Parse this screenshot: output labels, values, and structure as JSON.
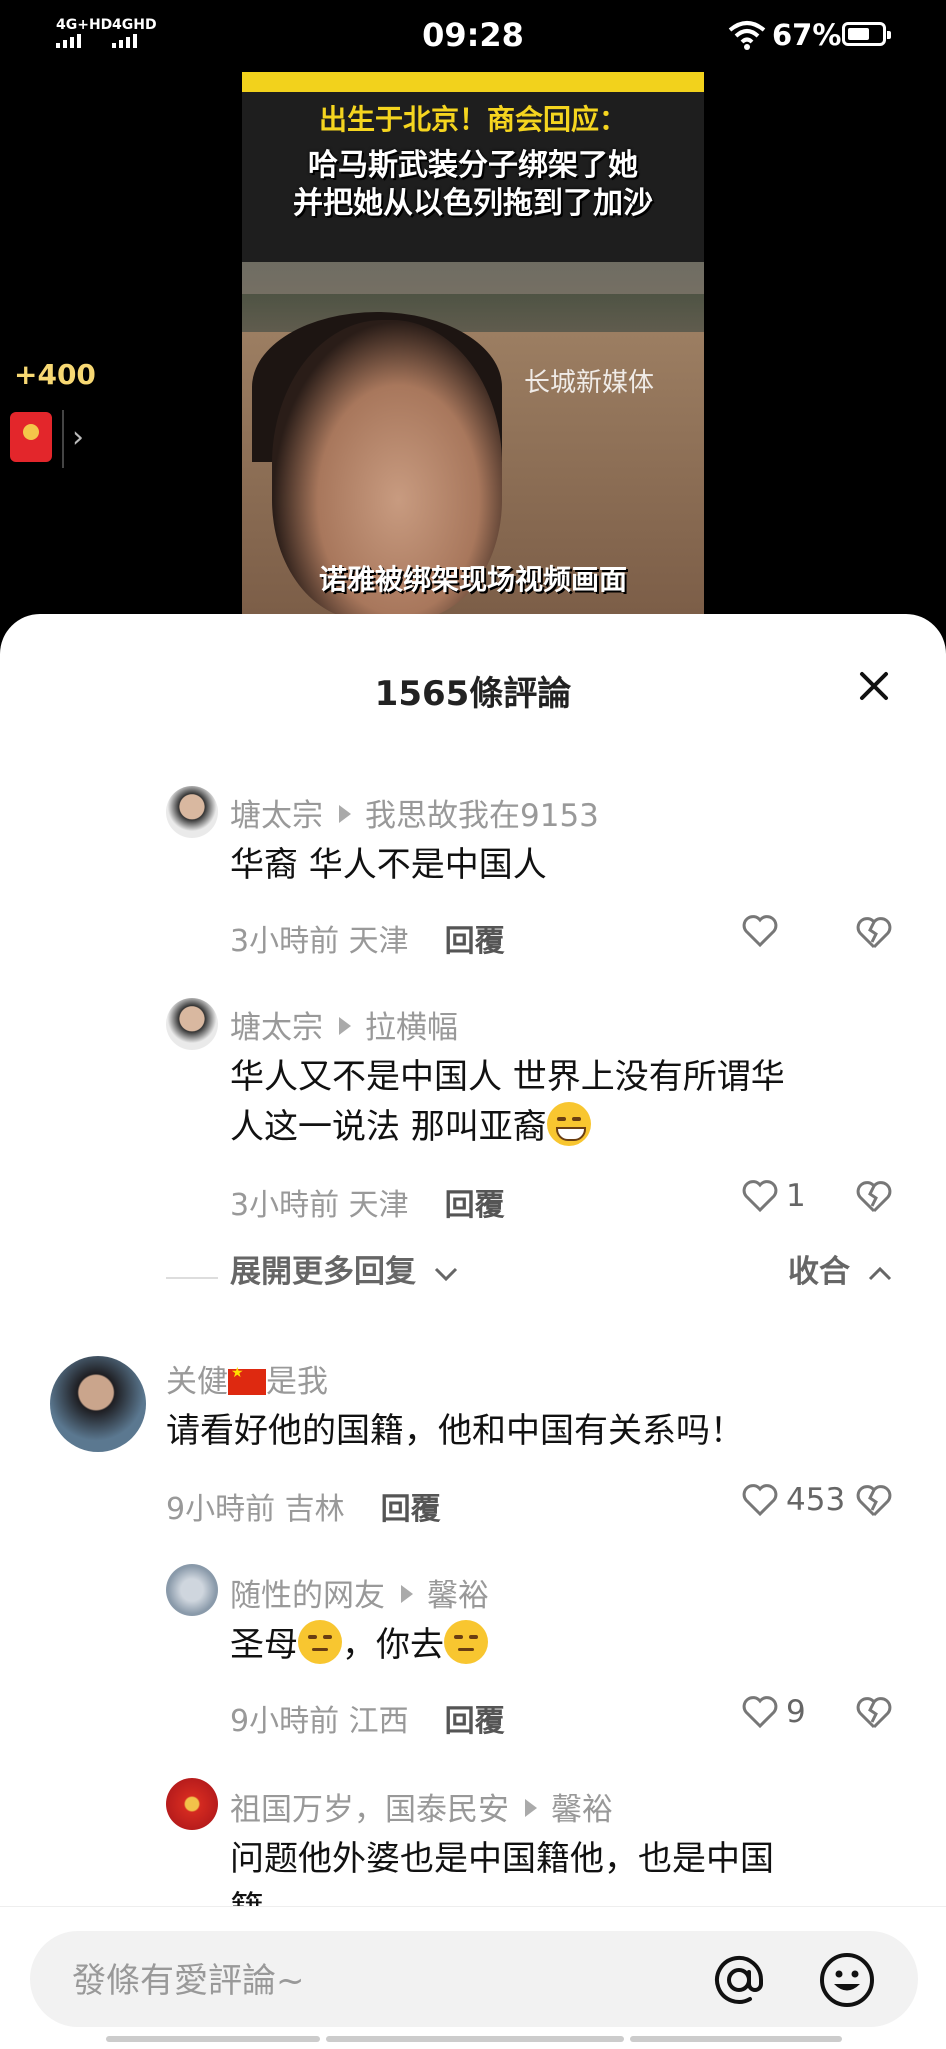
{
  "status_bar": {
    "time": "09:28",
    "sim1": "4G+HD",
    "sim2": "4GHD",
    "battery_pct": "67%",
    "battery_level": 0.67
  },
  "video": {
    "title_line1": "出生于北京！商会回应：",
    "title_line2": "哈马斯武装分子绑架了她",
    "title_line3": "并把她从以色列拖到了加沙",
    "watermark": "长城新媒体",
    "caption": "诺雅被绑架现场视频画面"
  },
  "reward": {
    "amount": "+400"
  },
  "sheet": {
    "title": "1565條評論",
    "comments": [
      {
        "user": "塘太宗",
        "reply_to": "我思故我在9153",
        "text": "华裔 华人不是中国人",
        "time": "3小時前",
        "location": "天津",
        "reply": "回覆",
        "likes": ""
      },
      {
        "user": "塘太宗",
        "reply_to": "拉横幅",
        "text_line1": "华人又不是中国人 世界上没有所谓华",
        "text_line2": "人这一说法 那叫亚裔",
        "time": "3小時前",
        "location": "天津",
        "reply": "回覆",
        "likes": "1"
      },
      {
        "user_prefix": "关健",
        "user_suffix": "是我",
        "text": "请看好他的国籍，他和中国有关系吗！",
        "time": "9小時前",
        "location": "吉林",
        "reply": "回覆",
        "likes": "453"
      },
      {
        "user": "随性的网友",
        "reply_to": "馨裕",
        "text_a": "圣母",
        "text_b": "，你去",
        "time": "9小時前",
        "location": "江西",
        "reply": "回覆",
        "likes": "9"
      },
      {
        "user": "祖国万岁，国泰民安",
        "reply_to": "馨裕",
        "text_line1": "问题他外婆也是中国籍他，也是中国",
        "text_line2": "籍"
      }
    ],
    "expand_label": "展開更多回复",
    "collapse_label": "收合"
  },
  "input": {
    "placeholder": "發條有愛評論~"
  },
  "colors": {
    "accent_gold": "#f7d873",
    "red_packet": "#e3262b",
    "meta_gray": "#999999"
  }
}
